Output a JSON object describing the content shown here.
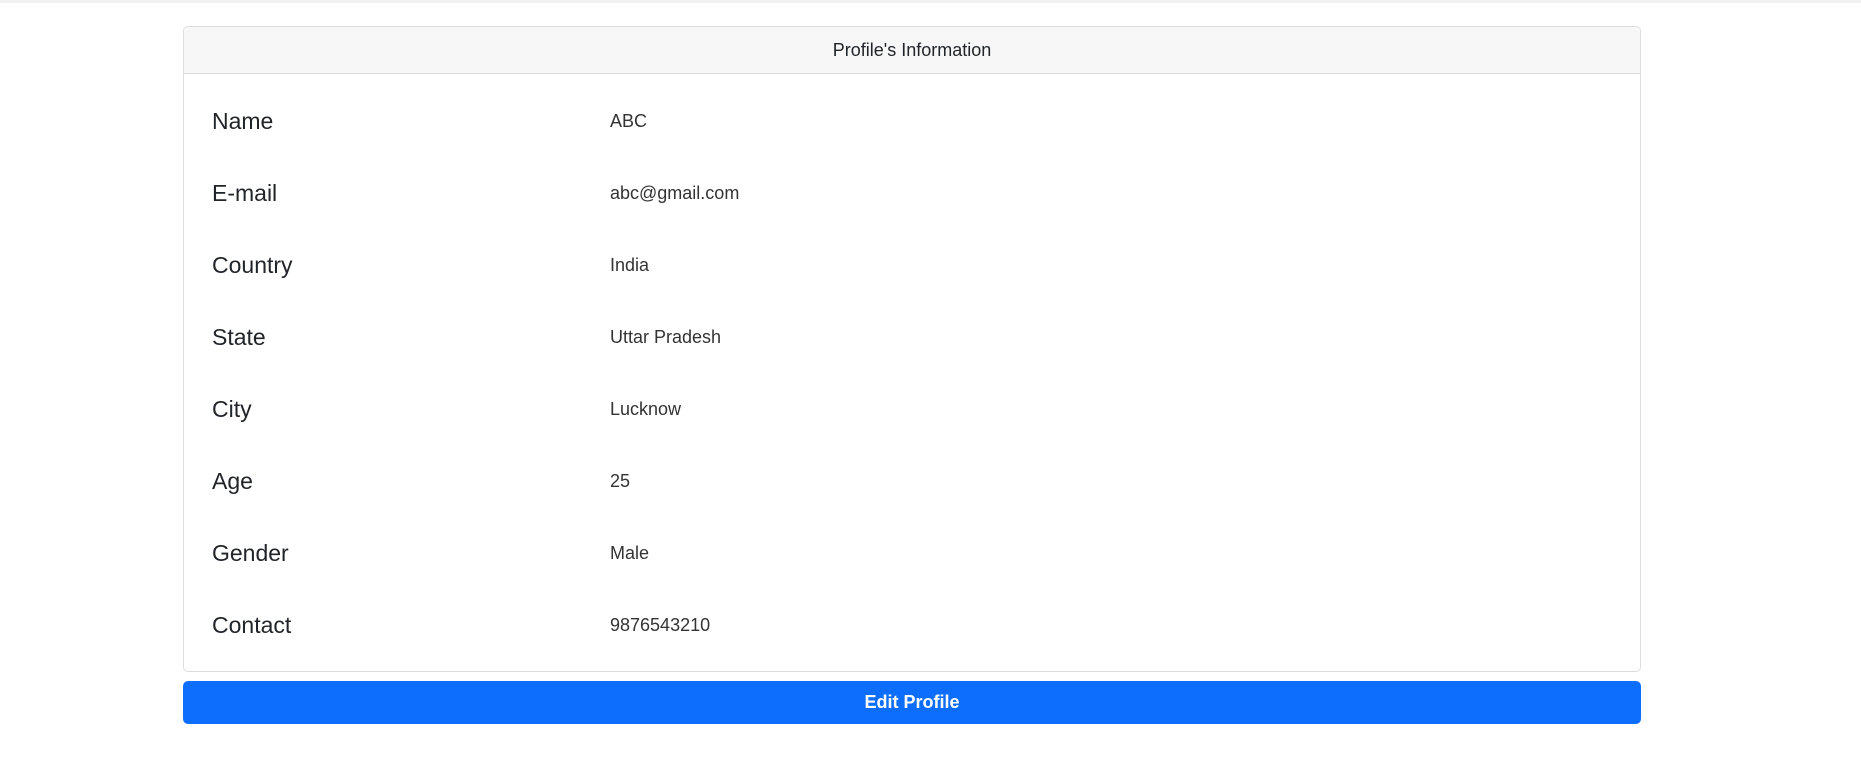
{
  "card": {
    "header": "Profile's Information",
    "rows": [
      {
        "label": "Name",
        "value": "ABC"
      },
      {
        "label": "E-mail",
        "value": "abc@gmail.com"
      },
      {
        "label": "Country",
        "value": "India"
      },
      {
        "label": "State",
        "value": "Uttar Pradesh"
      },
      {
        "label": "City",
        "value": "Lucknow"
      },
      {
        "label": "Age",
        "value": "25"
      },
      {
        "label": "Gender",
        "value": "Male"
      },
      {
        "label": "Contact",
        "value": "9876543210"
      }
    ]
  },
  "actions": {
    "edit_label": "Edit Profile"
  },
  "colors": {
    "primary": "#0d6efd",
    "header_bg": "#f7f7f7",
    "border": "#dcdcdc"
  }
}
